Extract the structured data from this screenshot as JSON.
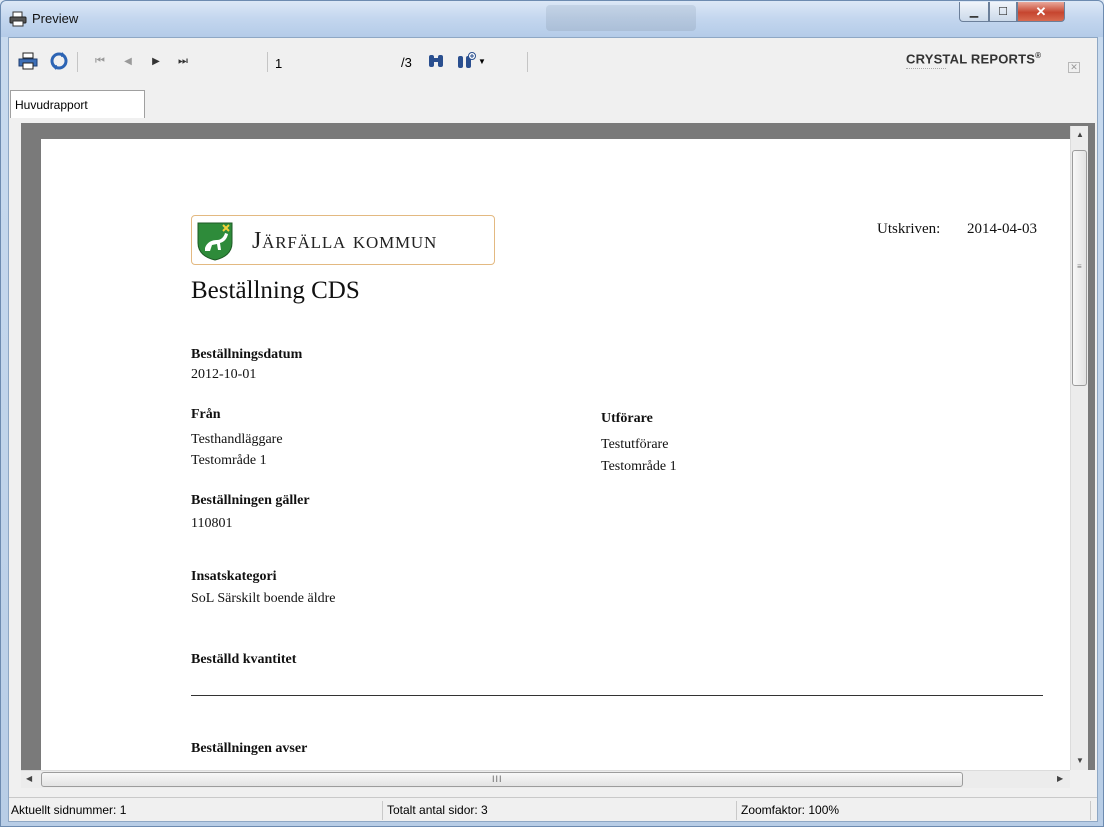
{
  "window": {
    "title": "Preview"
  },
  "toolbar": {
    "page_current": "1",
    "page_total": "/3",
    "brand": "CRYSTAL REPORTS",
    "brand_mark": "®"
  },
  "tabs": [
    {
      "label": "Huvudrapport"
    }
  ],
  "report": {
    "logo_text": "Järfälla kommun",
    "printed_label": "Utskriven:",
    "printed_date": "2014-04-03",
    "title": "Beställning CDS",
    "order_date_label": "Beställningsdatum",
    "order_date": "2012-10-01",
    "from_label": "Från",
    "from_line1": "Testhandläggare",
    "from_line2": "Testområde 1",
    "performer_label": "Utförare",
    "performer_line1": "Testutförare",
    "performer_line2": "Testområde 1",
    "applies_label": "Beställningen gäller",
    "applies_value": "110801",
    "category_label": "Insatskategori",
    "category_value": "SoL Särskilt boende äldre",
    "quantity_label": "Beställd kvantitet",
    "concerns_label": "Beställningen avser"
  },
  "statusbar": {
    "current_page": "Aktuellt sidnummer: 1",
    "total_pages": "Totalt antal sidor: 3",
    "zoom": "Zoomfaktor: 100%"
  },
  "icons": {
    "print": "printer-icon",
    "refresh": "refresh-icon",
    "first": "first-page-icon",
    "prev": "previous-page-icon",
    "next": "next-page-icon",
    "last": "last-page-icon",
    "find": "binoculars-icon",
    "zoom": "zoom-icon"
  },
  "colors": {
    "titlebar": "#c3d6ee",
    "close_button": "#c6452f",
    "logo_green": "#2e8b3a",
    "logo_border": "#e3b981"
  }
}
